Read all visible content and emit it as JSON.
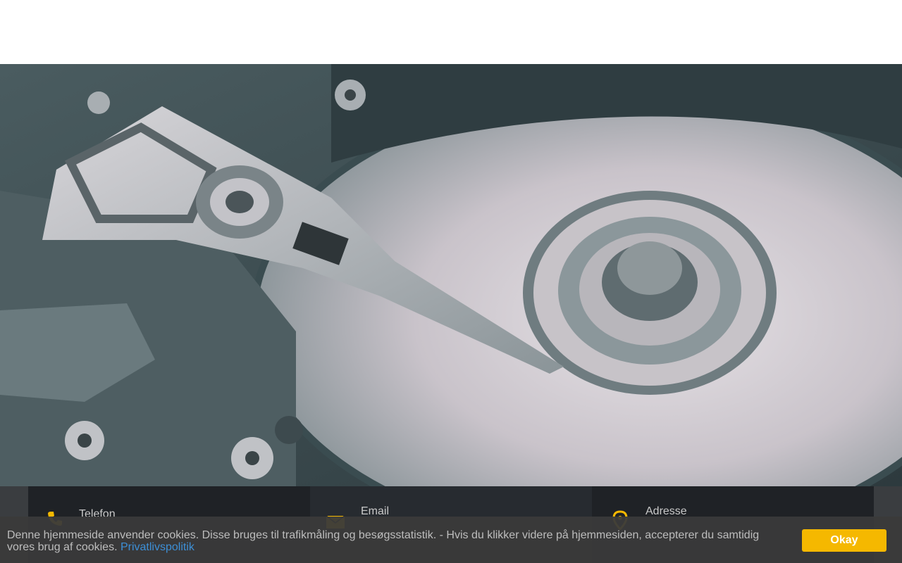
{
  "colors": {
    "accent": "#f5b800",
    "link": "#3d8fd6",
    "contact_bg_dark": "#1f2226",
    "contact_bg_mid": "#272b30",
    "cookie_bg": "#3a3a3a"
  },
  "hero": {
    "image_description_icon": "hard-drive-image"
  },
  "contact": {
    "phone": {
      "label": "Telefon",
      "icon": "phone-icon"
    },
    "email": {
      "label": "Email",
      "icon": "envelope-icon"
    },
    "address": {
      "label": "Adresse",
      "icon": "map-pin-icon"
    }
  },
  "cookie": {
    "text": "Denne hjemmeside anvender cookies. Disse bruges til trafikmåling og besøgsstatistik. - Hvis du klikker videre på hjemmesiden, accepterer du samtidig vores brug af cookies. ",
    "link_label": "Privatlivspolitik",
    "button_label": "Okay"
  }
}
